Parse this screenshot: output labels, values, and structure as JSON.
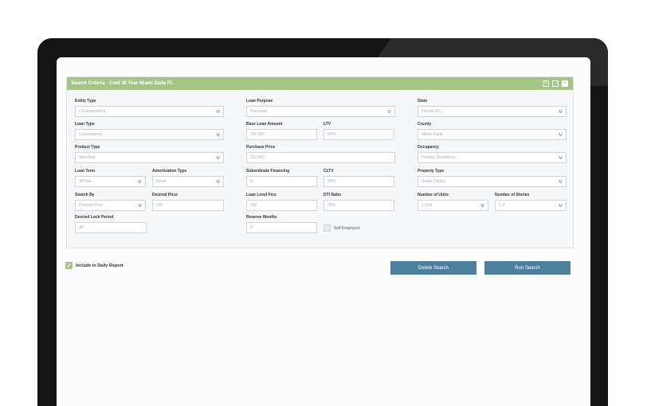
{
  "panel": {
    "title": "Search Criteria - Conf 30 Year Miami Dade FL",
    "icons": [
      "edit-icon",
      "copy-icon",
      "add-icon"
    ]
  },
  "fields": {
    "entity_type": {
      "label": "Entity Type",
      "value": "Correspondent"
    },
    "loan_purpose": {
      "label": "Loan Purpose",
      "value": "Purchase"
    },
    "state": {
      "label": "State",
      "value": "Florida (FL)"
    },
    "loan_type": {
      "label": "Loan Type",
      "value": "Conventional"
    },
    "base_loan_amount": {
      "label": "Base Loan Amount",
      "value": "250,000"
    },
    "ltv": {
      "label": "LTV",
      "value": "80%"
    },
    "county": {
      "label": "County",
      "value": "Miami-Dade"
    },
    "product_type": {
      "label": "Product Type",
      "value": "Standard"
    },
    "purchase_price": {
      "label": "Purchase Price",
      "value": "312,500"
    },
    "occupancy": {
      "label": "Occupancy",
      "value": "Primary Residence"
    },
    "loan_term": {
      "label": "Loan Term",
      "value": "30Year"
    },
    "amortization_type": {
      "label": "Amortization Type",
      "value": "Fixed"
    },
    "subordinate_financing": {
      "label": "Subordinate Financing",
      "value": "0"
    },
    "cltv": {
      "label": "CLTV",
      "value": "80%"
    },
    "property_type": {
      "label": "Property Type",
      "value": "Single Family"
    },
    "search_by": {
      "label": "Search By",
      "value": "Desired Price"
    },
    "desired_price": {
      "label": "Desired Price",
      "value": "102"
    },
    "loan_level_fico": {
      "label": "Loan Level Fico",
      "value": "740"
    },
    "dti_ratio": {
      "label": "DTI Ratio",
      "value": "25%"
    },
    "number_of_units": {
      "label": "Number of Units",
      "value": "1 Unit"
    },
    "number_of_stories": {
      "label": "Number of Stories",
      "value": "1-3"
    },
    "desired_lock_period": {
      "label": "Desired Lock Period",
      "value": "30"
    },
    "reserve_months": {
      "label": "Reserve Months",
      "value": "0"
    },
    "self_employed": {
      "label": "Self Employed",
      "checked": false
    }
  },
  "include_daily": {
    "label": "Include in Daily Report",
    "checked": true
  },
  "buttons": {
    "delete": "Delete Search",
    "run": "Run Search"
  },
  "colors": {
    "header_green": "#a4c586",
    "button_blue": "#4e7f9d"
  }
}
